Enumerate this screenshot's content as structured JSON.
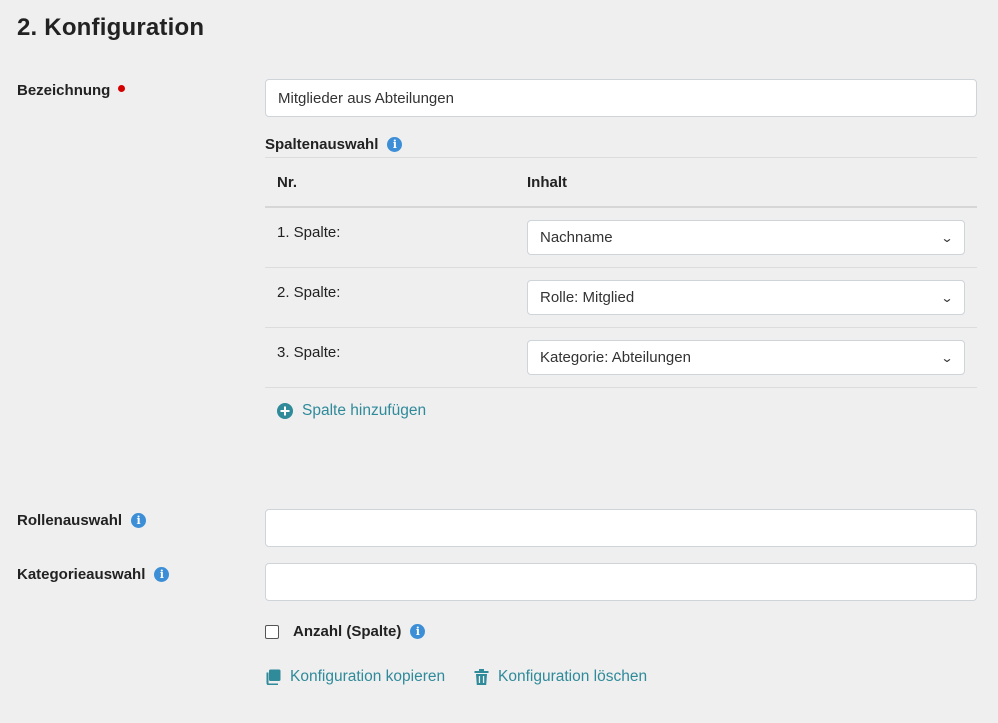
{
  "section_title": "2. Konfiguration",
  "bezeichnung": {
    "label": "Bezeichnung",
    "value": "Mitglieder aus Abteilungen"
  },
  "spaltenauswahl": {
    "label": "Spaltenauswahl",
    "columns": {
      "nr": "Nr.",
      "inhalt": "Inhalt"
    },
    "rows": [
      {
        "nr": "1. Spalte:",
        "value": "Nachname"
      },
      {
        "nr": "2. Spalte:",
        "value": "Rolle: Mitglied"
      },
      {
        "nr": "3. Spalte:",
        "value": "Kategorie: Abteilungen"
      }
    ],
    "add_label": "Spalte hinzufügen"
  },
  "rollenauswahl": {
    "label": "Rollenauswahl",
    "value": ""
  },
  "kategorieauswahl": {
    "label": "Kategorieauswahl",
    "value": ""
  },
  "anzahl": {
    "label": "Anzahl (Spalte)",
    "checked": false
  },
  "actions": {
    "copy_label": "Konfiguration kopieren",
    "delete_label": "Konfiguration löschen"
  },
  "colors": {
    "accent": "#2f8a9a",
    "info": "#3c8fd6",
    "required": "#d40000"
  }
}
